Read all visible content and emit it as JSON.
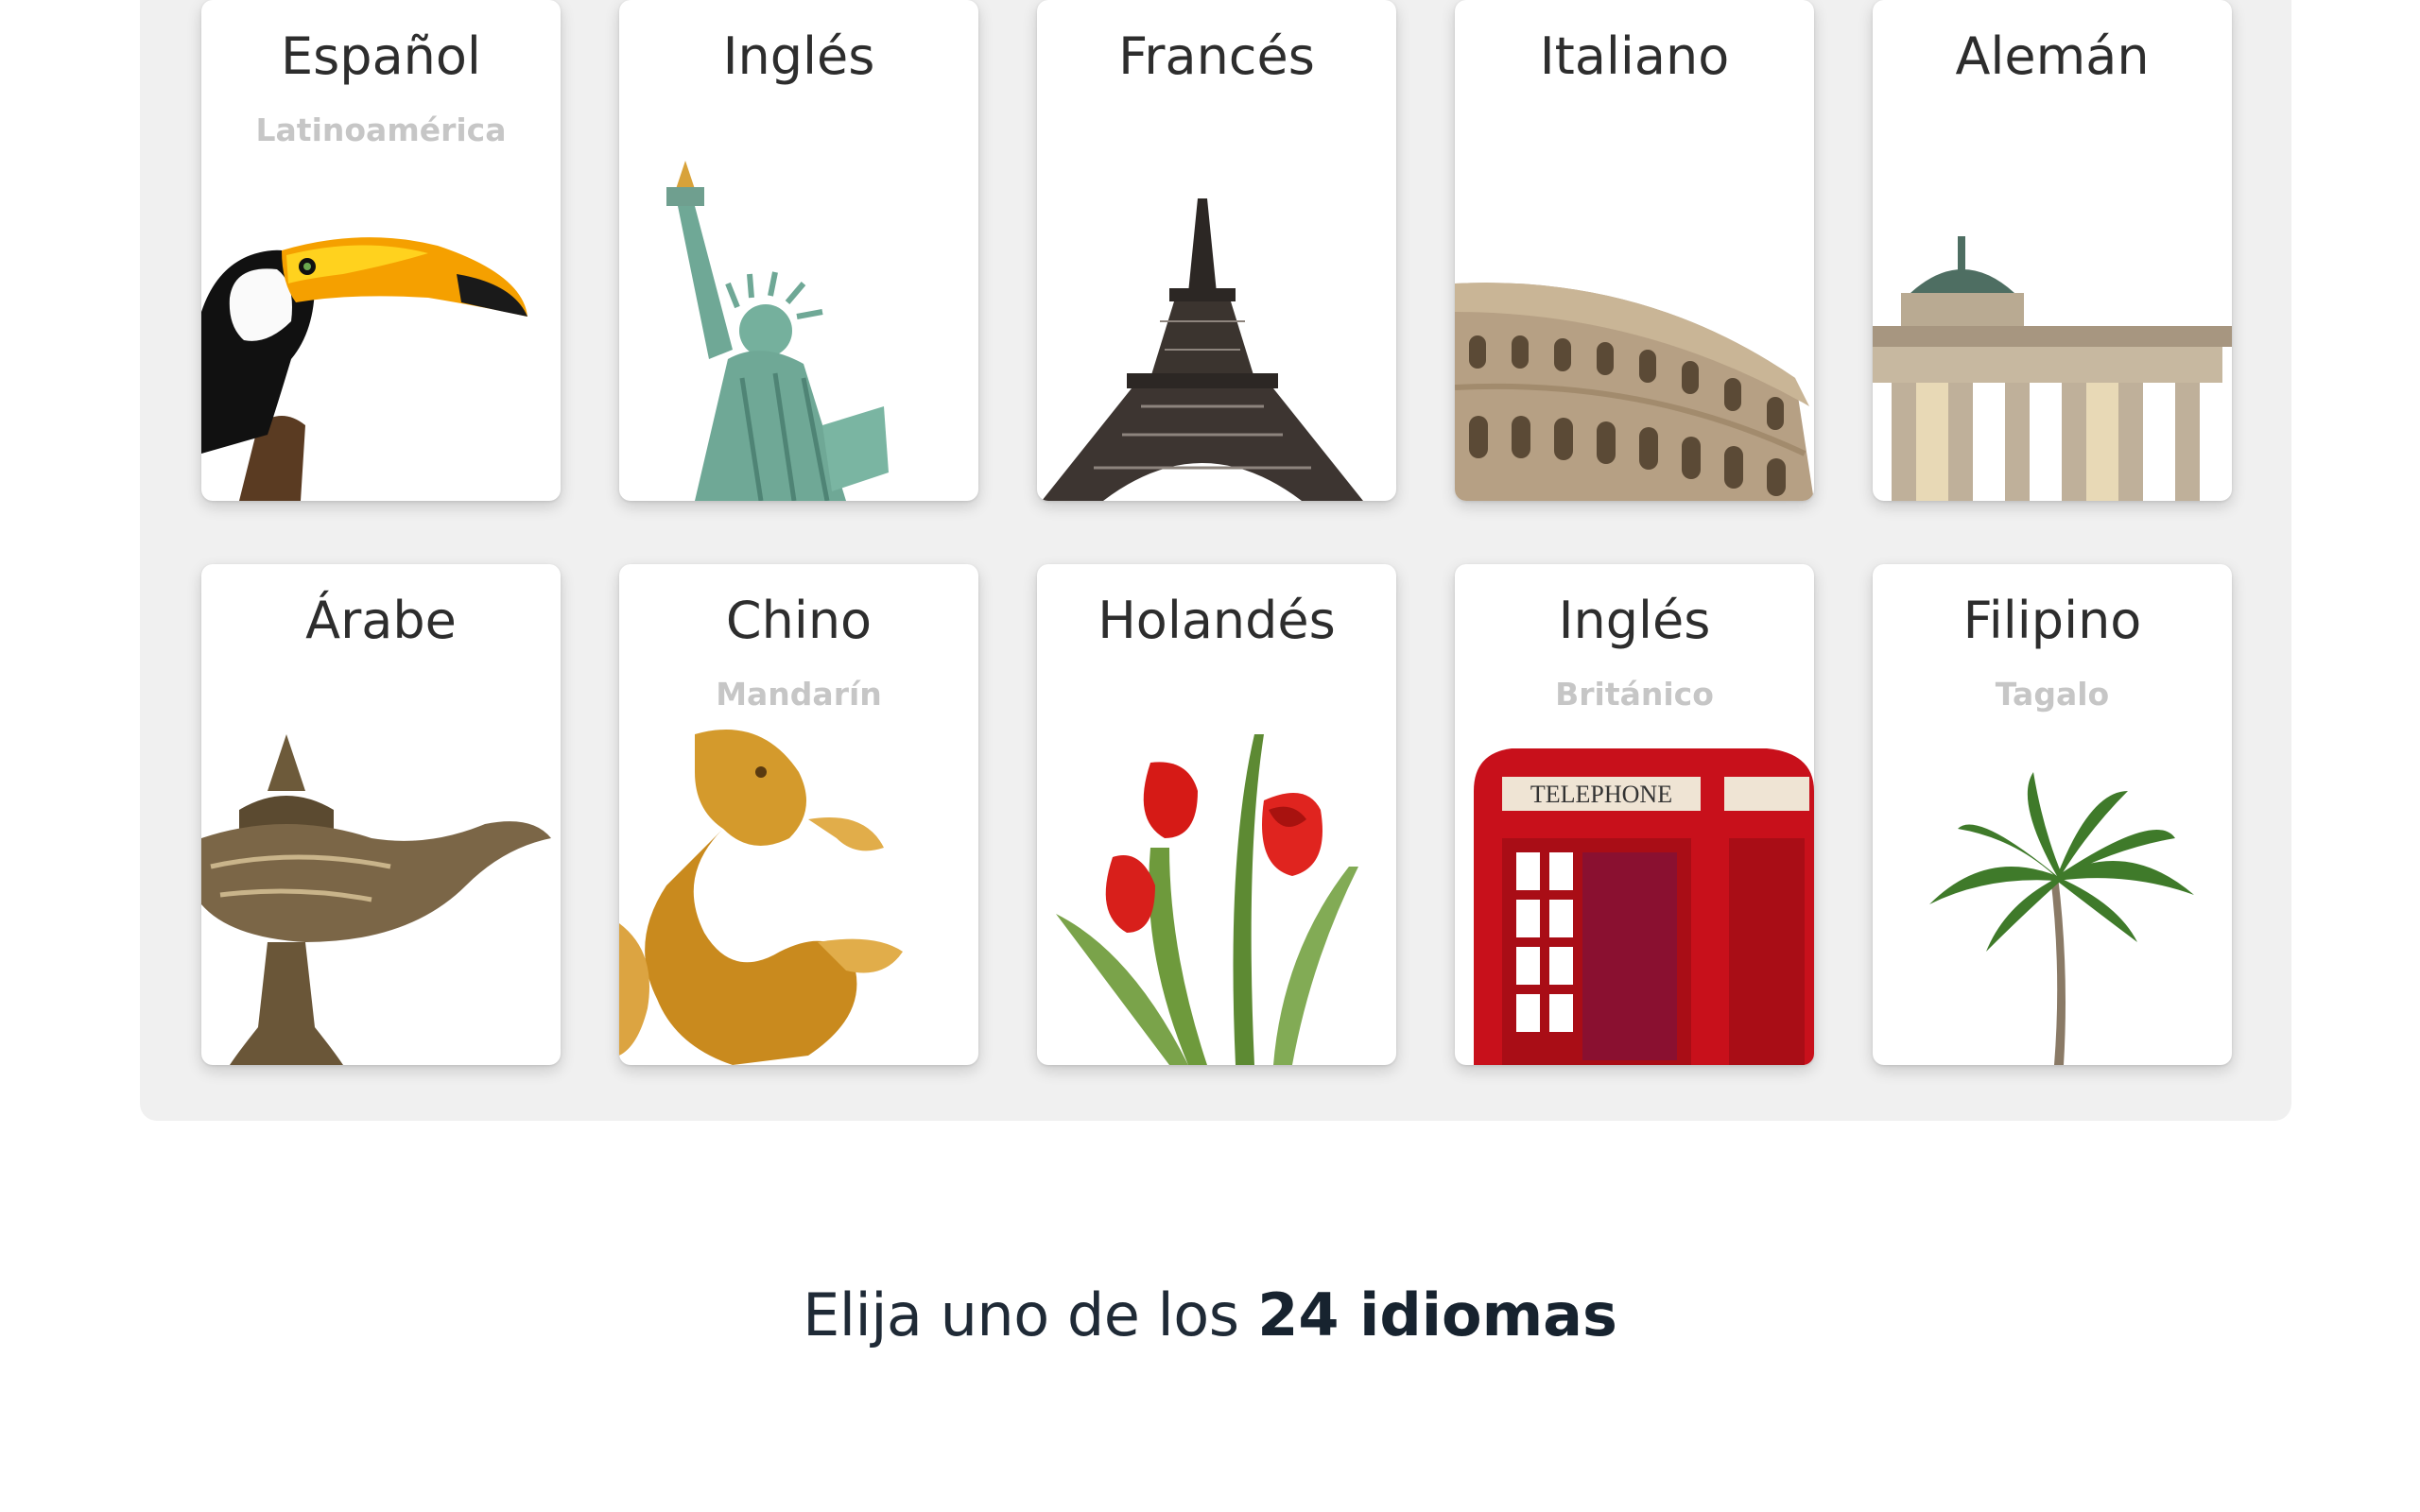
{
  "languages": [
    {
      "name": "Español",
      "sub": "Latinoamérica",
      "icon": "toucan-icon"
    },
    {
      "name": "Inglés",
      "sub": "",
      "icon": "statue-of-liberty-icon"
    },
    {
      "name": "Francés",
      "sub": "",
      "icon": "eiffel-tower-icon"
    },
    {
      "name": "Italiano",
      "sub": "",
      "icon": "colosseum-icon"
    },
    {
      "name": "Alemán",
      "sub": "",
      "icon": "brandenburg-gate-icon"
    },
    {
      "name": "Árabe",
      "sub": "",
      "icon": "magic-lamp-icon"
    },
    {
      "name": "Chino",
      "sub": "Mandarín",
      "icon": "dragon-icon"
    },
    {
      "name": "Holandés",
      "sub": "",
      "icon": "tulips-icon"
    },
    {
      "name": "Inglés",
      "sub": "Británico",
      "icon": "telephone-booth-icon"
    },
    {
      "name": "Filipino",
      "sub": "Tagalo",
      "icon": "palm-tree-icon"
    }
  ],
  "booth_sign": "TELEPHONE",
  "footer": {
    "prefix": "Elija uno de los",
    "highlight": "24 idiomas"
  }
}
